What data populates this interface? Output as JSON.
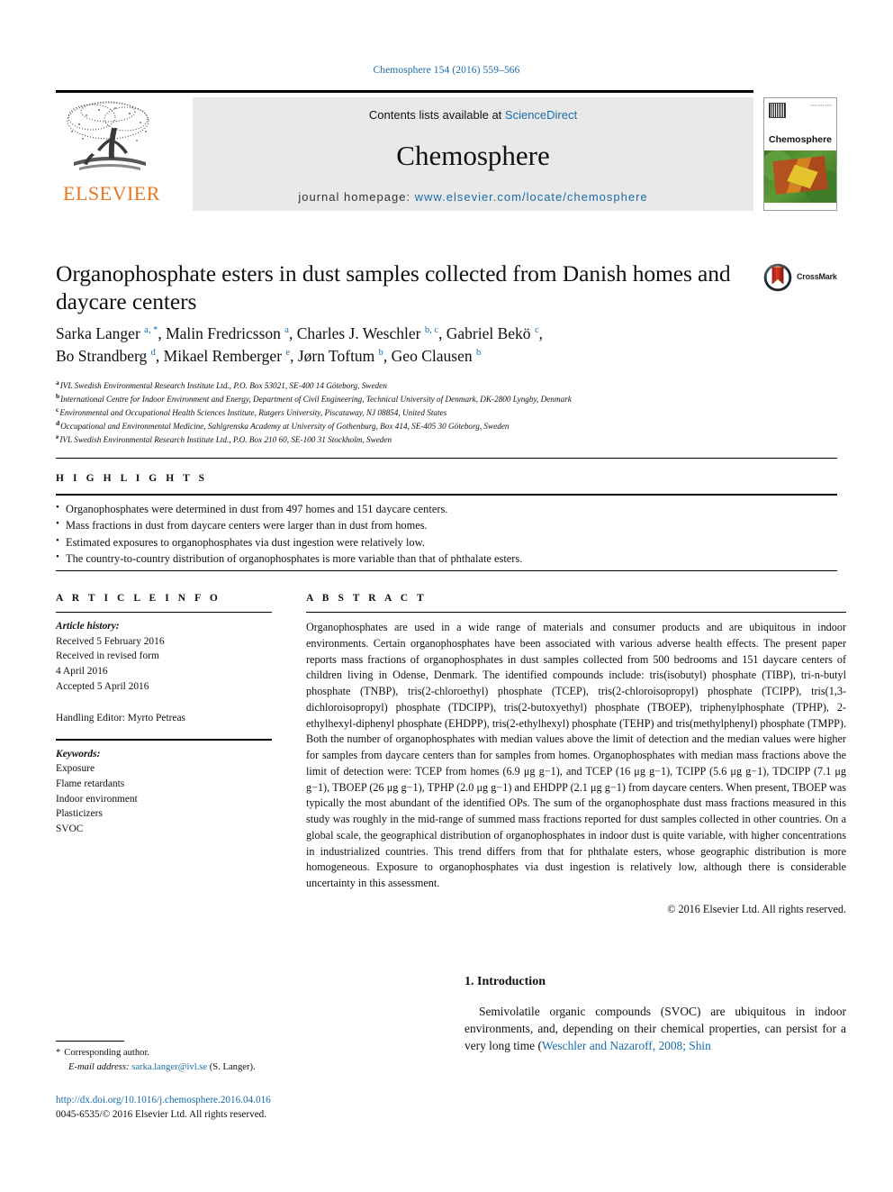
{
  "running_head": "Chemosphere 154 (2016) 559–566",
  "masthead": {
    "contents_prefix": "Contents lists available at ",
    "sciencedirect": "ScienceDirect",
    "journal_title": "Chemosphere",
    "homepage_label": "journal homepage: ",
    "homepage_url": "www.elsevier.com/locate/chemosphere",
    "publisher_wordmark": "ELSEVIER",
    "cover_journal_name": "Chemosphere",
    "cover_tiny_text": "ISSN 0045-6535"
  },
  "article": {
    "title": "Organophosphate esters in dust samples collected from Danish homes and daycare centers",
    "crossmark_label": "CrossMark",
    "authors_line1": "Sarka Langer <sup>a, *</sup>, Malin Fredricsson <sup>a</sup>, Charles J. Weschler <sup>b, c</sup>, Gabriel Bekö <sup>c</sup>,",
    "authors_line2": "Bo Strandberg <sup>d</sup>, Mikael Remberger <sup>e</sup>, Jørn Toftum <sup>b</sup>, Geo Clausen <sup>b</sup>",
    "affiliations": [
      {
        "label": "a",
        "text": "IVL Swedish Environmental Research Institute Ltd., P.O. Box 53021, SE-400 14 Göteborg, Sweden"
      },
      {
        "label": "b",
        "text": "International Centre for Indoor Environment and Energy, Department of Civil Engineering, Technical University of Denmark, DK-2800 Lyngby, Denmark"
      },
      {
        "label": "c",
        "text": "Environmental and Occupational Health Sciences Institute, Rutgers University, Piscataway, NJ 08854, United States"
      },
      {
        "label": "d",
        "text": "Occupational and Environmental Medicine, Sahlgrenska Academy at University of Gothenburg, Box 414, SE-405 30 Göteborg, Sweden"
      },
      {
        "label": "e",
        "text": "IVL Swedish Environmental Research Institute Ltd., P.O. Box 210 60, SE-100 31 Stockholm, Sweden"
      }
    ]
  },
  "highlights": {
    "heading": "H I G H L I G H T S",
    "items": [
      "Organophosphates were determined in dust from 497 homes and 151 daycare centers.",
      "Mass fractions in dust from daycare centers were larger than in dust from homes.",
      "Estimated exposures to organophosphates via dust ingestion were relatively low.",
      "The country-to-country distribution of organophosphates is more variable than that of phthalate esters."
    ]
  },
  "article_info": {
    "heading": "A R T I C L E   I N F O",
    "history_label": "Article history:",
    "history": [
      "Received 5 February 2016",
      "Received in revised form",
      "4 April 2016",
      "Accepted 5 April 2016"
    ],
    "handling_editor": "Handling Editor: Myrto Petreas",
    "keywords_label": "Keywords:",
    "keywords": [
      "Exposure",
      "Flame retardants",
      "Indoor environment",
      "Plasticizers",
      "SVOC"
    ]
  },
  "abstract": {
    "heading": "A B S T R A C T",
    "text": "Organophosphates are used in a wide range of materials and consumer products and are ubiquitous in indoor environments. Certain organophosphates have been associated with various adverse health effects. The present paper reports mass fractions of organophosphates in dust samples collected from 500 bedrooms and 151 daycare centers of children living in Odense, Denmark. The identified compounds include: tris(isobutyl) phosphate (TIBP), tri-n-butyl phosphate (TNBP), tris(2-chloroethyl) phosphate (TCEP), tris(2-chloroisopropyl) phosphate (TCIPP), tris(1,3-dichloroisopropyl) phosphate (TDCIPP), tris(2-butoxyethyl) phosphate (TBOEP), triphenylphosphate (TPHP), 2-ethylhexyl-diphenyl phosphate (EHDPP), tris(2-ethylhexyl) phosphate (TEHP) and tris(methylphenyl) phosphate (TMPP). Both the number of organophosphates with median values above the limit of detection and the median values were higher for samples from daycare centers than for samples from homes. Organophosphates with median mass fractions above the limit of detection were: TCEP from homes (6.9 μg g−1), and TCEP (16 μg g−1), TCIPP (5.6 μg g−1), TDCIPP (7.1 μg g−1), TBOEP (26 μg g−1), TPHP (2.0 μg g−1) and EHDPP (2.1 μg g−1) from daycare centers. When present, TBOEP was typically the most abundant of the identified OPs. The sum of the organophosphate dust mass fractions measured in this study was roughly in the mid-range of summed mass fractions reported for dust samples collected in other countries. On a global scale, the geographical distribution of organophosphates in indoor dust is quite variable, with higher concentrations in industrialized countries. This trend differs from that for phthalate esters, whose geographic distribution is more homogeneous. Exposure to organophosphates via dust ingestion is relatively low, although there is considerable uncertainty in this assessment.",
    "copyright": "© 2016 Elsevier Ltd. All rights reserved."
  },
  "introduction": {
    "heading": "1. Introduction",
    "paragraph_plain": "Semivolatile organic compounds (SVOC) are ubiquitous in indoor environments, and, depending on their chemical properties, can persist for a very long time (",
    "citation": "Weschler and Nazaroff, 2008; Shin"
  },
  "footer": {
    "corresponding_label": "Corresponding author.",
    "email_label": "E-mail address:",
    "email": "sarka.langer@ivl.se",
    "email_suffix": "(S. Langer).",
    "doi": "http://dx.doi.org/10.1016/j.chemosphere.2016.04.016",
    "issn_line": "0045-6535/© 2016 Elsevier Ltd. All rights reserved."
  },
  "colors": {
    "link_blue": "#1a6ca8",
    "elsevier_orange": "#E87722",
    "masthead_gray": "#e9e9e9"
  }
}
